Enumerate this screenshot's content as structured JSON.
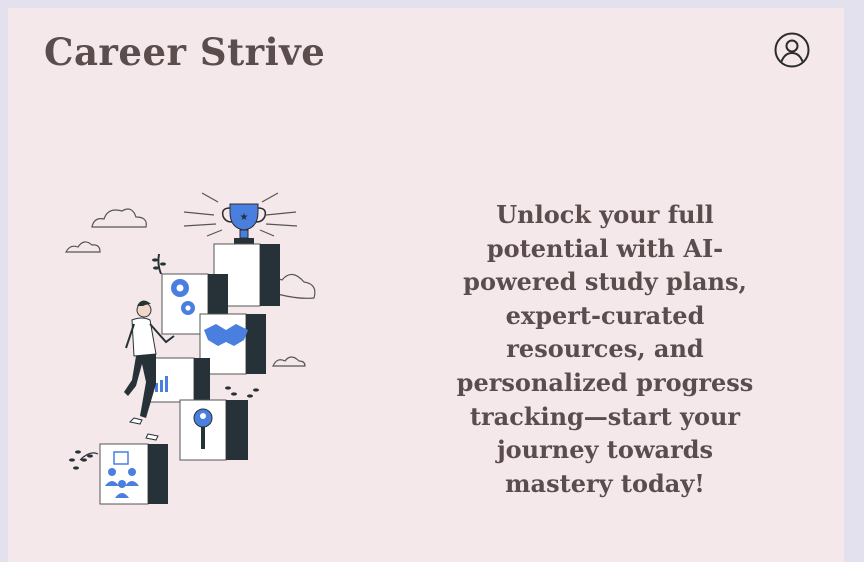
{
  "header": {
    "brand": "Career Strive",
    "account_icon": "user-circle-icon"
  },
  "hero": {
    "illustration": "career-ladder-illustration",
    "tagline": "Unlock your full potential with AI-powered study plans, expert-curated resources, and personalized progress tracking—start your journey towards mastery today!"
  },
  "colors": {
    "background": "#f5e8ea",
    "outer_frame": "#e4e1ee",
    "text": "#5b4d4e",
    "illustration_accent": "#4a7fe0",
    "illustration_dark": "#263238"
  }
}
